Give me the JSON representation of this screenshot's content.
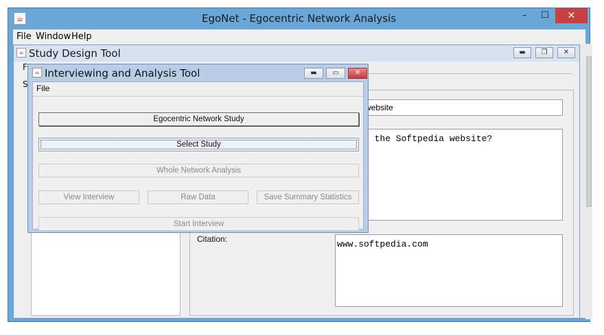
{
  "window": {
    "title": "EgoNet - Egocentric Network Analysis",
    "min_glyph": "–",
    "max_glyph": "☐",
    "close_glyph": "✕"
  },
  "menubar": [
    "File",
    "Window",
    "Help"
  ],
  "study_design_tool": {
    "title": "Study Design Tool",
    "fragments": {
      "f": "F",
      "s": "S"
    },
    "name_value": "website",
    "description_value": "s the Softpedia website?",
    "citation_label": "Citation:",
    "citation_value": "www.softpedia.com"
  },
  "analysis_tool": {
    "title": "Interviewing and Analysis Tool",
    "menu_file": "File",
    "buttons": {
      "egocentric": "Egocentric Network Study",
      "select_study": "Select Study",
      "whole_network": "Whole Network Analysis",
      "view_interview": "View Interview",
      "raw_data": "Raw Data",
      "save_summary": "Save Summary Statistics",
      "start_interview": "Start Interview"
    }
  },
  "icons": {
    "app": "java-cup-icon",
    "minimize": "minimize-icon",
    "maximize": "maximize-icon",
    "close": "close-icon"
  }
}
